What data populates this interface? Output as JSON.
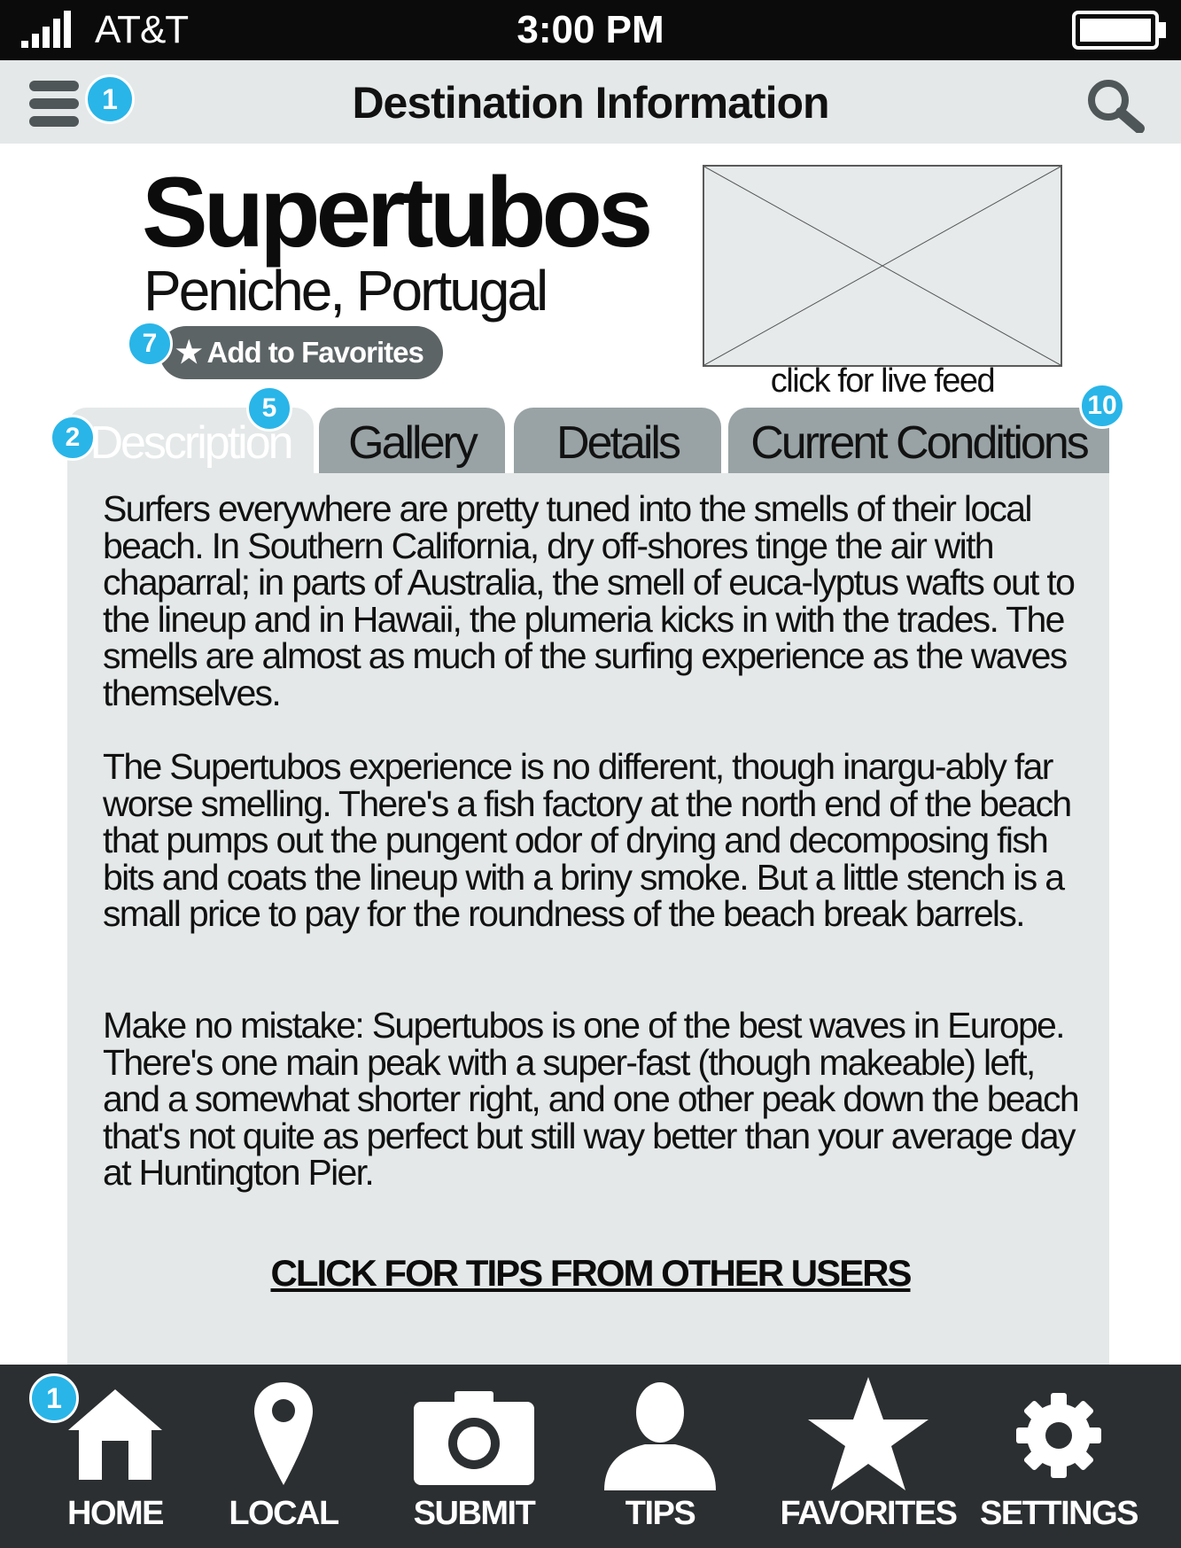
{
  "status_bar": {
    "carrier": "AT&T",
    "time": "3:00 PM"
  },
  "header": {
    "title": "Destination Information",
    "menu_badge": "1"
  },
  "destination": {
    "name": "Supertubos",
    "location": "Peniche, Portugal",
    "favorite_badge": "7",
    "favorite_label": "Add to Favorites",
    "live_feed_caption": "click for live feed"
  },
  "tabs": [
    {
      "label": "Description",
      "badge": "2"
    },
    {
      "label": "Gallery",
      "badge": "5"
    },
    {
      "label": "Details"
    },
    {
      "label": "Current Conditions",
      "badge": "10"
    }
  ],
  "description": {
    "paragraphs": [
      "Surfers everywhere are pretty tuned into the smells of their local beach. In Southern California, dry off-shores tinge the air with chaparral; in parts of Australia, the smell of euca-lyptus wafts out to the lineup and in Hawaii, the plumeria kicks in with the trades. The smells are almost as much of the surfing experience as the waves themselves.",
      "The Supertubos experience is no different, though inargu-ably far worse smelling. There's a fish factory at the north end of the beach that pumps out the pungent odor of drying and decomposing fish bits and coats the lineup with a briny smoke. But a little stench is a small price to pay for the roundness of the beach break barrels.",
      "Make no mistake: Supertubos is one of the best waves in Europe. There's one main peak with a super-fast (though makeable) left, and a somewhat shorter right, and one other peak down the beach that's not quite as perfect but still way better than your average day at Huntington Pier."
    ],
    "tips_link": "CLICK FOR TIPS FROM OTHER USERS"
  },
  "bottom_nav": {
    "badge": "1",
    "items": [
      {
        "label": "HOME",
        "icon": "home-icon"
      },
      {
        "label": "LOCAL",
        "icon": "location-pin-icon"
      },
      {
        "label": "SUBMIT",
        "icon": "camera-icon"
      },
      {
        "label": "TIPS",
        "icon": "user-icon"
      },
      {
        "label": "FAVORITES",
        "icon": "star-icon"
      },
      {
        "label": "SETTINGS",
        "icon": "gear-icon"
      }
    ]
  },
  "colors": {
    "accent_badge": "#29b5e8",
    "panel_bg": "#e4e8e8",
    "tab_inactive": "#99a3a5",
    "nav_bg": "#2c2f31",
    "status_bg": "#0b0b0b"
  }
}
